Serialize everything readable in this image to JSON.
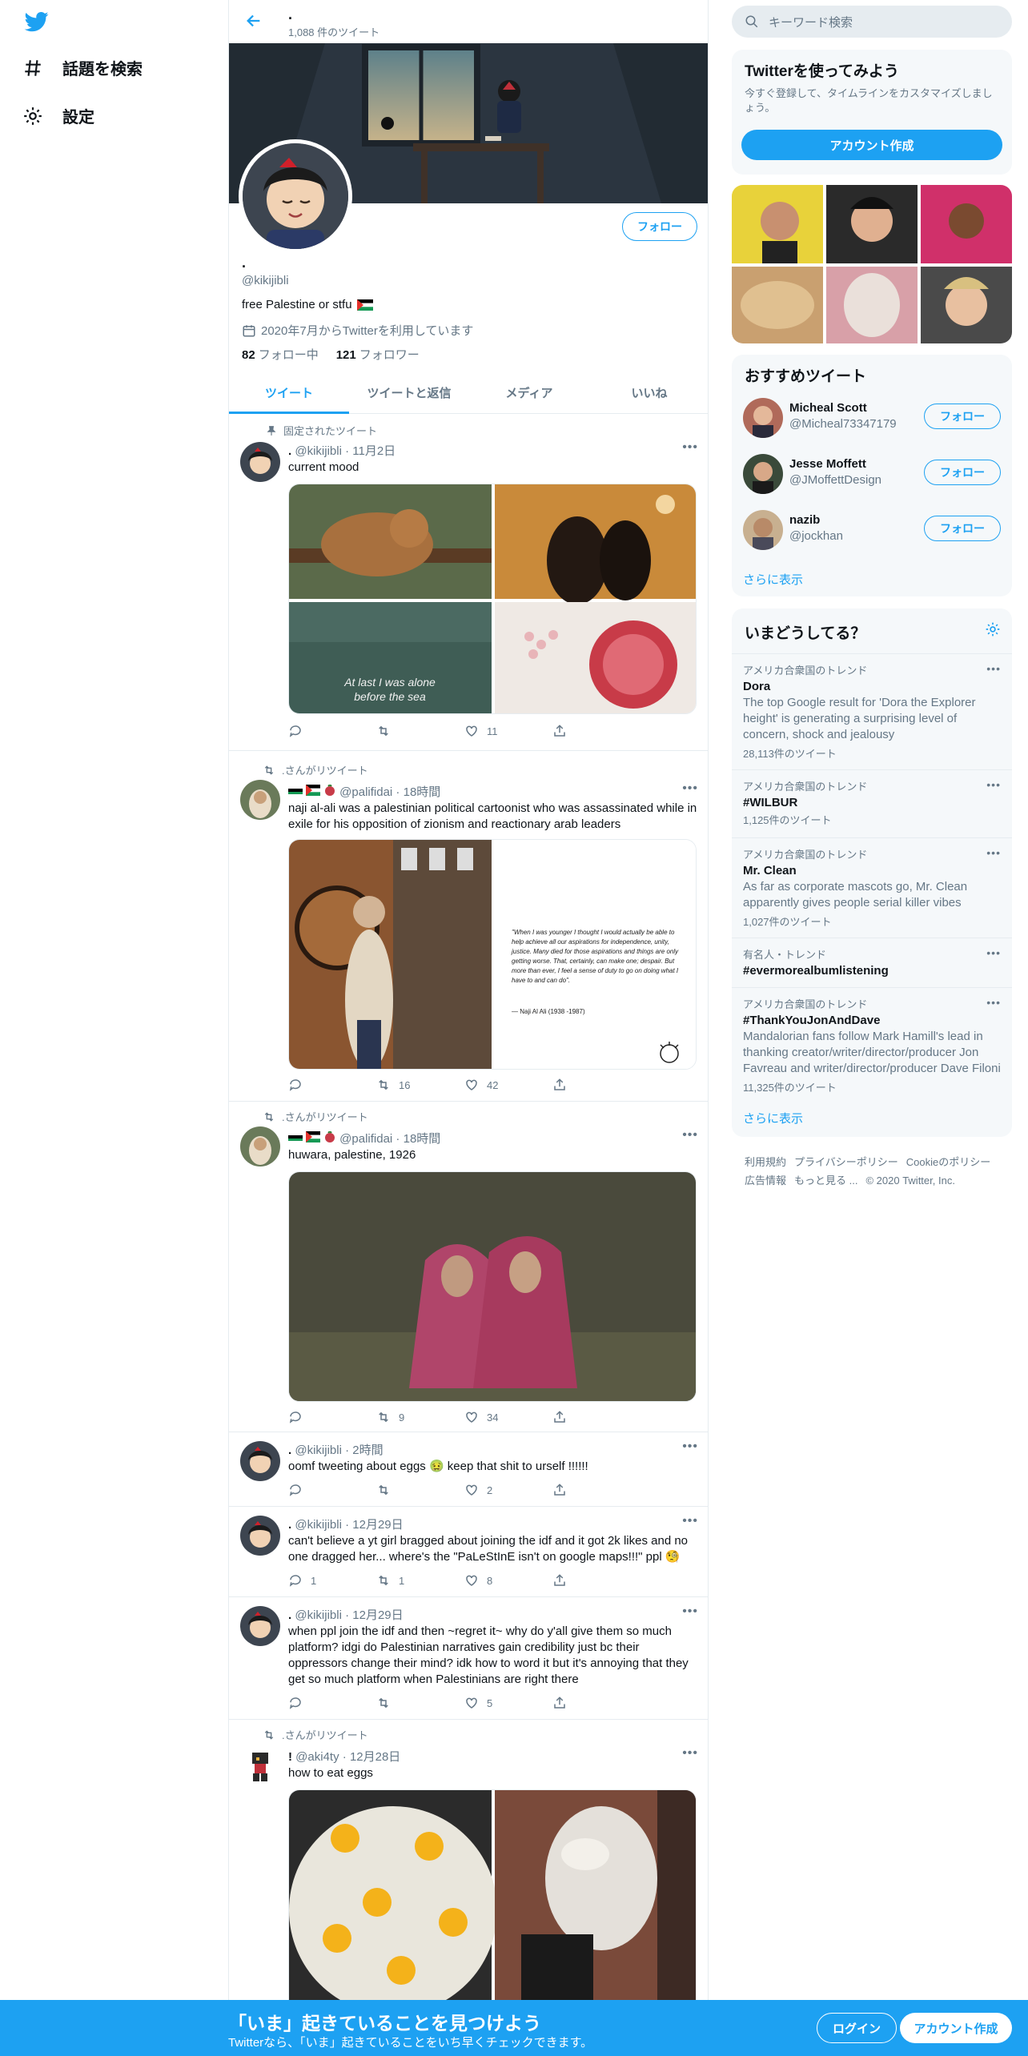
{
  "nav": {
    "explore": "話題を検索",
    "settings": "設定"
  },
  "profile": {
    "top_name": ".",
    "tweet_count": "1,088 件のツイート",
    "follow_label": "フォロー",
    "name": ".",
    "handle": "@kikijibli",
    "bio": "free Palestine or stfu",
    "joined": "2020年7月からTwitterを利用しています",
    "following_count": "82",
    "following_label": "フォロー中",
    "followers_count": "121",
    "followers_label": "フォロワー"
  },
  "tabs": [
    "ツイート",
    "ツイートと返信",
    "メディア",
    "いいね"
  ],
  "tweets": [
    {
      "context": "固定されたツイート",
      "name": ".",
      "handle": "@kikijibli",
      "time": "11月2日",
      "text": "current mood",
      "media_caption": "At last I was alone before the sea",
      "reply": "",
      "retweet": "",
      "like": "11"
    },
    {
      "context": ".さんがリツイート",
      "name": "",
      "handle": "@palifidai",
      "time": "18時間",
      "text": "naji al-ali was a palestinian political cartoonist who was assassinated while in exile for his opposition of zionism and reactionary arab leaders",
      "quote": "\"When I was younger I thought I would actually be able to help achieve all our aspirations for independence, unity, justice. Many died for those aspirations and things are only getting worse. That, certainly, can make one; despair. But more than ever, I feel a sense of duty to go on doing what I have to and can do\".",
      "quote_author": "— Naji Al Ali (1938 -1987)",
      "reply": "",
      "retweet": "16",
      "like": "42"
    },
    {
      "context": ".さんがリツイート",
      "name": "",
      "handle": "@palifidai",
      "time": "18時間",
      "text": "huwara, palestine, 1926",
      "reply": "",
      "retweet": "9",
      "like": "34"
    },
    {
      "name": ".",
      "handle": "@kikijibli",
      "time": "2時間",
      "text": "oomf tweeting about eggs 🤢 keep that shit to urself !!!!!!",
      "reply": "",
      "retweet": "",
      "like": "2"
    },
    {
      "name": ".",
      "handle": "@kikijibli",
      "time": "12月29日",
      "text": "can't believe a yt girl bragged about joining the idf and it got 2k likes and no one dragged her... where's the \"PaLeStInE isn't on google maps!!!\" ppl 🧐",
      "reply": "1",
      "retweet": "1",
      "like": "8"
    },
    {
      "name": ".",
      "handle": "@kikijibli",
      "time": "12月29日",
      "text": "when ppl join the idf and then ~regret it~ why do y'all give them so much platform? idgi do Palestinian narratives gain credibility just bc their oppressors change their mind? idk how to word it but it's annoying that they get so much platform when Palestinians are right there",
      "reply": "",
      "retweet": "",
      "like": "5"
    },
    {
      "context": ".さんがリツイート",
      "name": "!",
      "handle": "@aki4ty",
      "time": "12月28日",
      "text": "how to eat eggs"
    }
  ],
  "right": {
    "search_placeholder": "キーワード検索",
    "signup_card": {
      "title": "Twitterを使ってみよう",
      "desc": "今すぐ登録して、タイムラインをカスタマイズしましょう。",
      "button": "アカウント作成"
    },
    "recommended": {
      "title": "おすすめツイート",
      "users": [
        {
          "name": "Micheal Scott",
          "handle": "@Micheal73347179",
          "button": "フォロー"
        },
        {
          "name": "Jesse Moffett",
          "handle": "@JMoffettDesign",
          "button": "フォロー"
        },
        {
          "name": "nazib",
          "handle": "@jockhan",
          "button": "フォロー"
        }
      ],
      "more": "さらに表示"
    },
    "trends": {
      "title": "いまどうしてる？",
      "items": [
        {
          "context": "アメリカ合衆国のトレンド",
          "name": "Dora",
          "desc": "The top Google result for 'Dora the Explorer height' is generating a surprising level of concern, shock and jealousy",
          "count": "28,113件のツイート"
        },
        {
          "context": "アメリカ合衆国のトレンド",
          "name": "#WILBUR",
          "desc": "",
          "count": "1,125件のツイート"
        },
        {
          "context": "アメリカ合衆国のトレンド",
          "name": "Mr. Clean",
          "desc": "As far as corporate mascots go, Mr. Clean apparently gives people serial killer vibes",
          "count": "1,027件のツイート"
        },
        {
          "context": "有名人・トレンド",
          "name": "#evermorealbumlistening",
          "desc": "",
          "count": ""
        },
        {
          "context": "アメリカ合衆国のトレンド",
          "name": "#ThankYouJonAndDave",
          "desc": "Mandalorian fans follow Mark Hamill's lead in thanking creator/writer/director/producer Jon Favreau and writer/director/producer Dave Filoni",
          "count": "11,325件のツイート"
        }
      ],
      "more": "さらに表示"
    },
    "footer": [
      "利用規約",
      "プライバシーポリシー",
      "Cookieのポリシー",
      "広告情報",
      "もっと見る ...",
      "© 2020 Twitter, Inc."
    ]
  },
  "bottom": {
    "title": "「いま」起きていることを見つけよう",
    "subtitle": "Twitterなら、「いま」起きていることをいち早くチェックできます。",
    "login": "ログイン",
    "signup": "アカウント作成"
  },
  "colors": {
    "accent": "#1da1f2",
    "muted": "#657786",
    "border": "#e6ecf0"
  }
}
